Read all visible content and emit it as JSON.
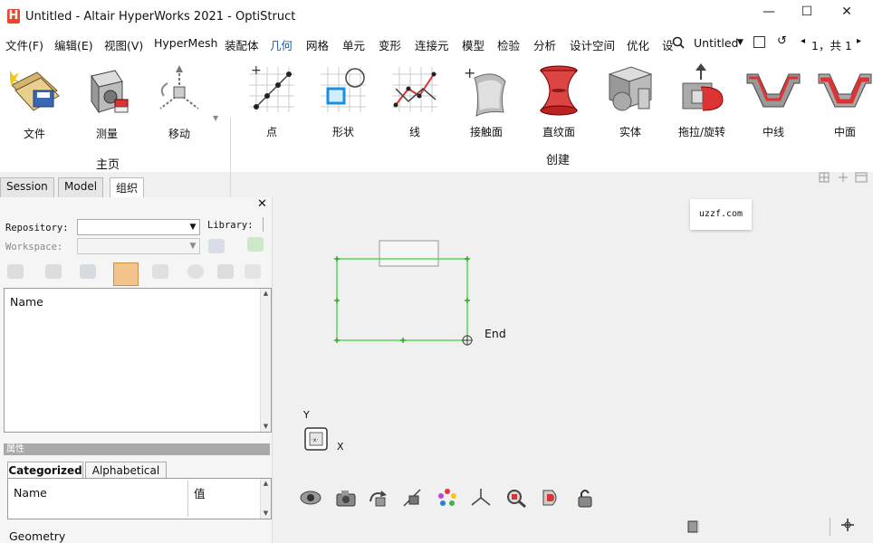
{
  "window": {
    "title": "Untitled - Altair HyperWorks 2021 - OptiStruct",
    "controls": {
      "minimize": "—",
      "maximize": "☐",
      "close": "✕"
    }
  },
  "menu": {
    "items": [
      "文件(F)",
      "编辑(E)",
      "视图(V)",
      "HyperMesh",
      "装配体",
      "几何",
      "网格",
      "单元",
      "变形",
      "连接元",
      "模型",
      "检验",
      "分析",
      "设计空间",
      "优化",
      "设"
    ],
    "active": "几何",
    "right": {
      "session_name": "Untitled",
      "page_indicator": "1，共 1"
    }
  },
  "ribbon": {
    "home_group": {
      "label": "主页",
      "tools": [
        "文件",
        "测量",
        "移动"
      ]
    },
    "create_group": {
      "label": "创建",
      "tools": [
        "点",
        "形状",
        "线",
        "接触面",
        "直纹面",
        "实体",
        "拖拉/旋转",
        "中线",
        "中面"
      ]
    }
  },
  "left_panel": {
    "tabs": [
      "Session",
      "Model",
      "组织"
    ],
    "active_tab": "组织",
    "repository_label": "Repository:",
    "library_label": "Library:",
    "workspace_label": "Workspace:",
    "list_header": "Name",
    "properties_header": "属性",
    "prop_tabs": [
      "Categorized",
      "Alphabetical"
    ],
    "prop_columns": [
      "Name",
      "值"
    ],
    "status": "Geometry"
  },
  "viewport": {
    "watermark": "uzzf.com",
    "end_label": "End",
    "axis": {
      "y": "Y",
      "x": "X"
    },
    "accent_color": "#44d544"
  }
}
